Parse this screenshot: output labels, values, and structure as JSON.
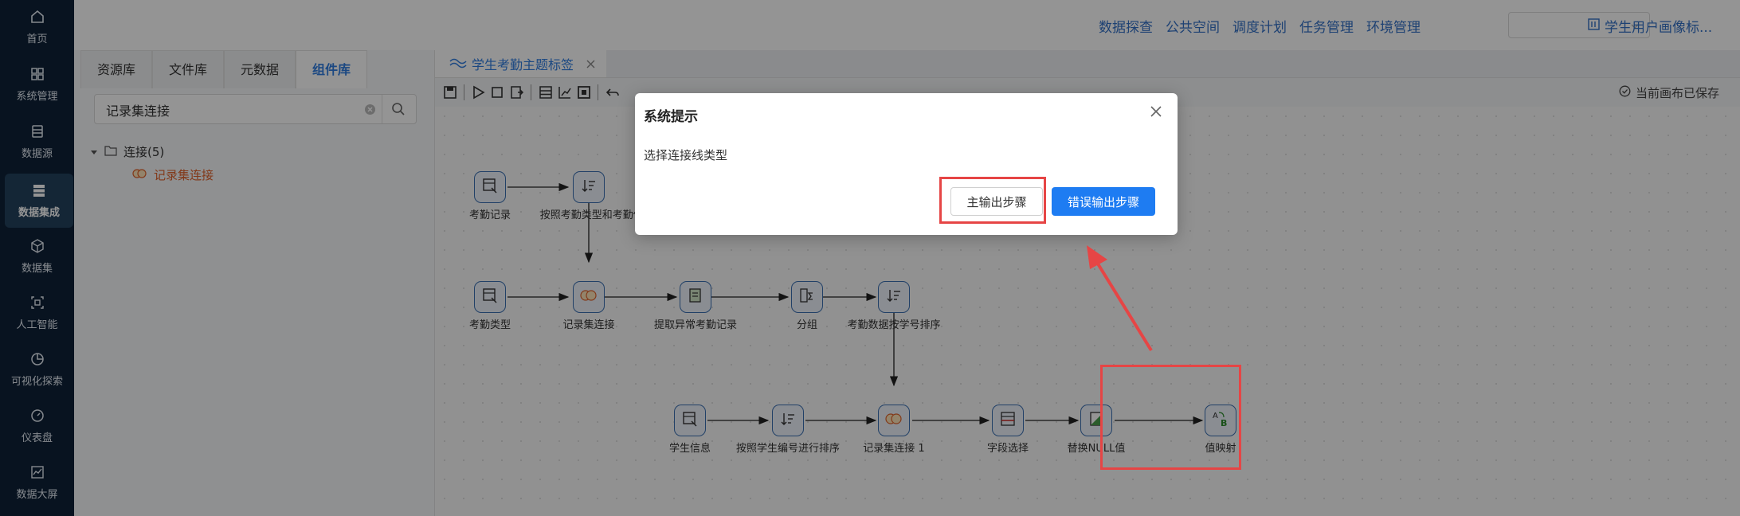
{
  "nav": {
    "items": [
      {
        "label": "首页",
        "icon": "home-icon"
      },
      {
        "label": "系统管理",
        "icon": "grid-icon"
      },
      {
        "label": "数据源",
        "icon": "database-icon"
      },
      {
        "label": "数据集成",
        "icon": "server-icon",
        "active": true
      },
      {
        "label": "数据集",
        "icon": "cube-icon"
      },
      {
        "label": "人工智能",
        "icon": "ai-icon"
      },
      {
        "label": "可视化探索",
        "icon": "pie-icon"
      },
      {
        "label": "仪表盘",
        "icon": "gauge-icon"
      },
      {
        "label": "数据大屏",
        "icon": "line-chart-icon"
      }
    ]
  },
  "header": {
    "links": [
      "数据探查",
      "公共空间",
      "调度计划",
      "任务管理",
      "环境管理"
    ],
    "select_value": "",
    "user_label": "学生用户画像标..."
  },
  "left_panel": {
    "tabs": [
      "资源库",
      "文件库",
      "元数据",
      "组件库"
    ],
    "active_tab": "组件库",
    "search_value": "记录集连接",
    "tree": {
      "folder": "连接(5)",
      "leaf": "记录集连接"
    }
  },
  "editor": {
    "tab_title": "学生考勤主题标签",
    "save_status": "当前画布已保存"
  },
  "canvas": {
    "nodes": [
      {
        "id": "n1",
        "label": "考勤记录"
      },
      {
        "id": "n2",
        "label": "按照考勤类型和考勤任..."
      },
      {
        "id": "n3",
        "label": "考勤类型"
      },
      {
        "id": "n4",
        "label": "记录集连接"
      },
      {
        "id": "n5",
        "label": "提取异常考勤记录"
      },
      {
        "id": "n6",
        "label": "分组"
      },
      {
        "id": "n7",
        "label": "考勤数据按学号排序"
      },
      {
        "id": "n8",
        "label": "学生信息"
      },
      {
        "id": "n9",
        "label": "按照学生编号进行排序"
      },
      {
        "id": "n10",
        "label": "记录集连接 1"
      },
      {
        "id": "n11",
        "label": "字段选择"
      },
      {
        "id": "n12",
        "label": "替换NULL值"
      },
      {
        "id": "n13",
        "label": "值映射"
      }
    ]
  },
  "dialog": {
    "title": "系统提示",
    "message": "选择连接线类型",
    "main_button": "主输出步骤",
    "error_button": "错误输出步骤"
  },
  "colors": {
    "accent": "#1e7cf2",
    "highlight": "#e64545",
    "nav_bg": "#0f2238",
    "node_border": "#3a6fb2"
  }
}
